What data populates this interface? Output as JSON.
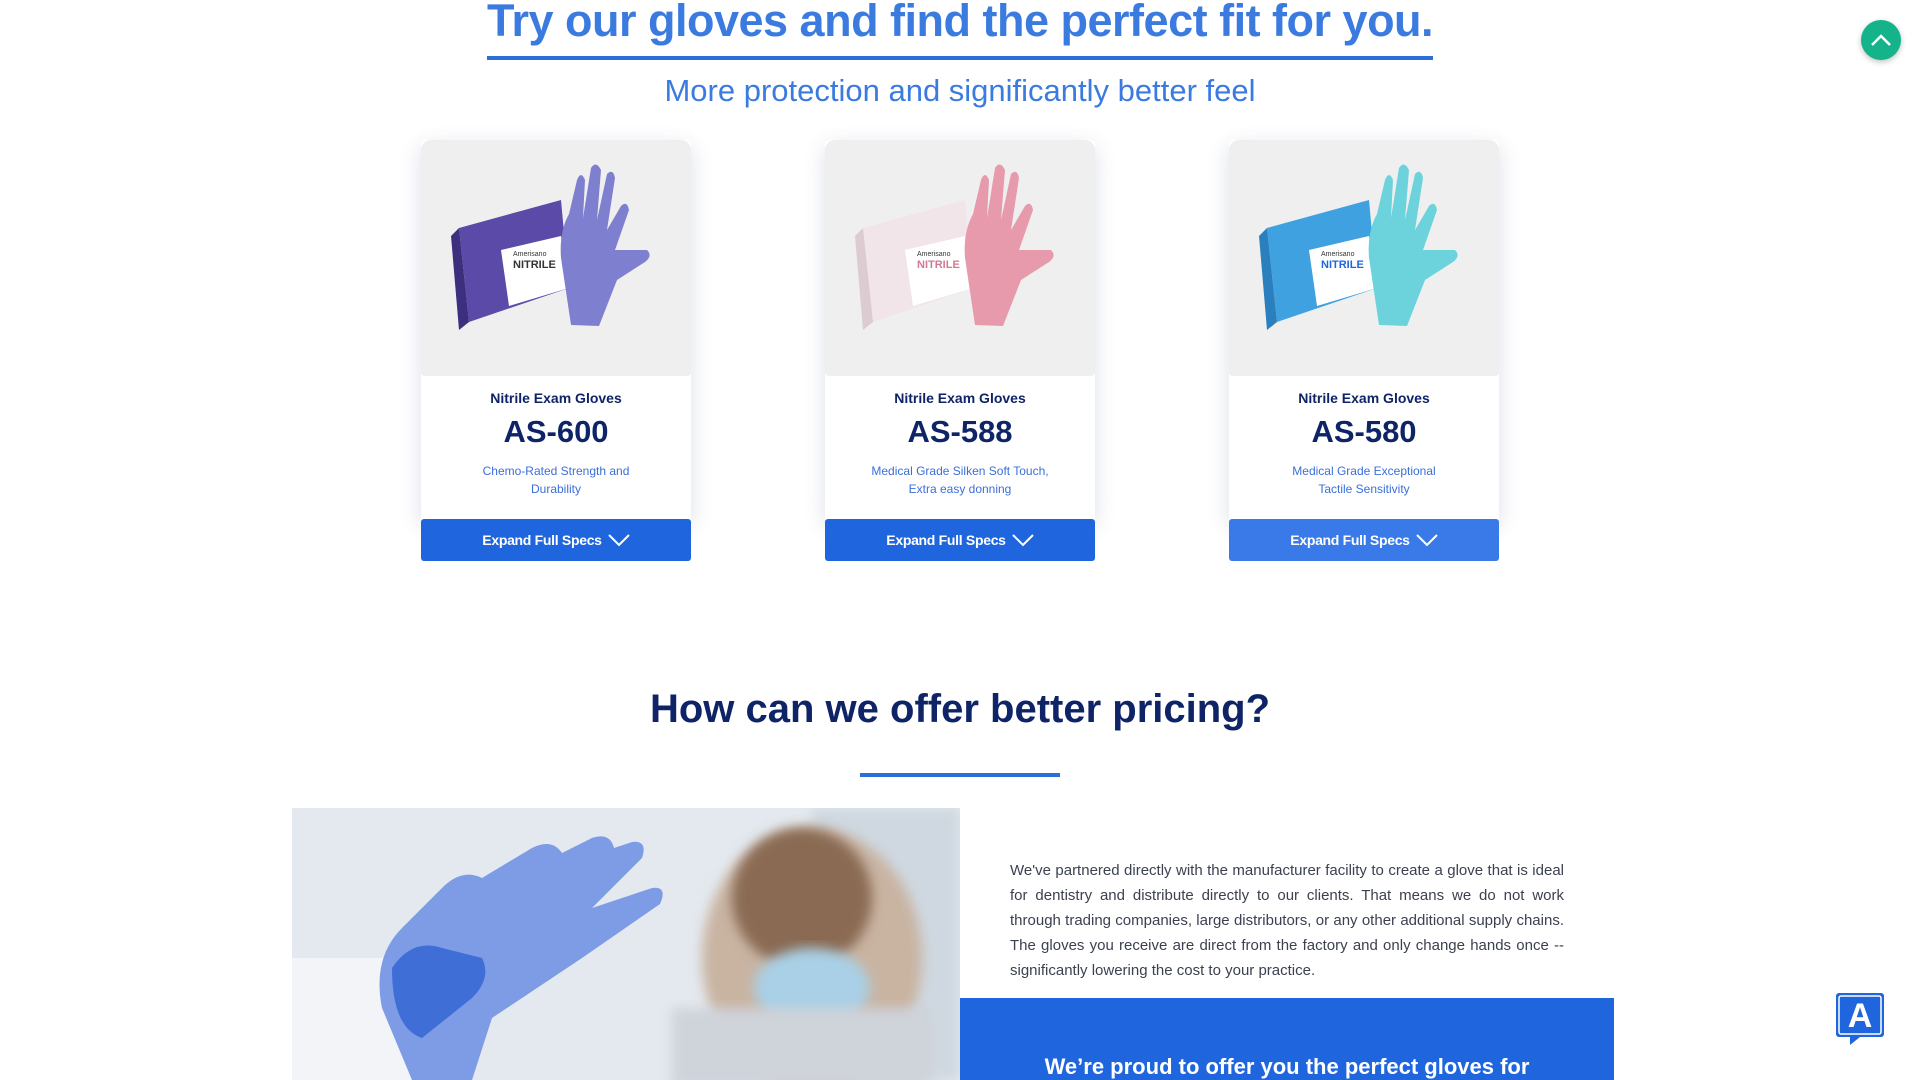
{
  "hero": {
    "title": "Try our gloves and find the perfect fit for you.",
    "subtitle": "More protection and significantly better feel"
  },
  "products": [
    {
      "category": "Nitrile Exam Gloves",
      "model": "AS-600",
      "description": "Chemo-Rated Strength and Durability",
      "button": "Expand Full Specs",
      "glove_color": "#7f7fd0",
      "box_color": "#5b4aa8"
    },
    {
      "category": "Nitrile Exam Gloves",
      "model": "AS-588",
      "description": "Medical Grade Silken Soft Touch, Extra easy donning",
      "button": "Expand Full Specs",
      "glove_color": "#e79aac",
      "box_color": "#f1e5e9"
    },
    {
      "category": "Nitrile Exam Gloves",
      "model": "AS-580",
      "description": "Medical Grade Exceptional Tactile Sensitivity",
      "button": "Expand Full Specs",
      "glove_color": "#6cd3dd",
      "box_color": "#3fa1df"
    }
  ],
  "box_label": {
    "brand": "Amerisano",
    "type": "NITRILE"
  },
  "pricing": {
    "title": "How can we offer better pricing?",
    "body": "We've partnered directly with the manufacturer facility to create a glove that is ideal for dentistry and distribute directly to our clients. That means we do not work through trading companies, large distributors, or any other additional supply chains. The gloves you receive are direct from the factory and only change hands once -- significantly lowering the cost to your practice.",
    "panel_text": "We’re proud to offer you the perfect gloves for"
  },
  "widgets": {
    "scroll_top_icon": "chevron-up-icon",
    "accessibility_icon": "translate-a-icon",
    "accent_color": "#1f66de",
    "scroll_color": "#14b38a"
  }
}
